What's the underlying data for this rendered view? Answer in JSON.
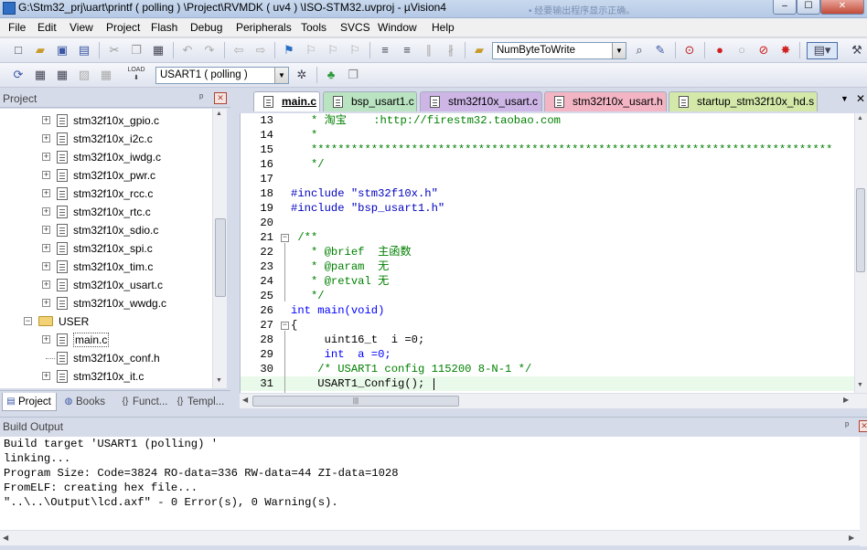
{
  "window": {
    "title": "G:\\Stm32_prj\\uart\\printf ( polling ) \\Project\\RVMDK ( uv4 ) \\ISO-STM32.uvproj - µVision4",
    "ghost_text": "• 经要输出程序显示正确。"
  },
  "menu": [
    "File",
    "Edit",
    "View",
    "Project",
    "Flash",
    "Debug",
    "Peripherals",
    "Tools",
    "SVCS",
    "Window",
    "Help"
  ],
  "toolbar": {
    "find_combo": "NumByteToWrite",
    "target_combo": "USART1 ( polling )",
    "load_label": "LOAD"
  },
  "project_panel": {
    "title": "Project",
    "pin": "ᵖ",
    "items": [
      {
        "label": "stm32f10x_gpio.c",
        "type": "file",
        "expandable": true
      },
      {
        "label": "stm32f10x_i2c.c",
        "type": "file",
        "expandable": true
      },
      {
        "label": "stm32f10x_iwdg.c",
        "type": "file",
        "expandable": true
      },
      {
        "label": "stm32f10x_pwr.c",
        "type": "file",
        "expandable": true
      },
      {
        "label": "stm32f10x_rcc.c",
        "type": "file",
        "expandable": true
      },
      {
        "label": "stm32f10x_rtc.c",
        "type": "file",
        "expandable": true
      },
      {
        "label": "stm32f10x_sdio.c",
        "type": "file",
        "expandable": true
      },
      {
        "label": "stm32f10x_spi.c",
        "type": "file",
        "expandable": true
      },
      {
        "label": "stm32f10x_tim.c",
        "type": "file",
        "expandable": true
      },
      {
        "label": "stm32f10x_usart.c",
        "type": "file",
        "expandable": true
      },
      {
        "label": "stm32f10x_wwdg.c",
        "type": "file",
        "expandable": true
      },
      {
        "label": "USER",
        "type": "folder",
        "expandable": true
      },
      {
        "label": "main.c",
        "type": "file",
        "expandable": true
      },
      {
        "label": "stm32f10x_conf.h",
        "type": "file",
        "expandable": false
      },
      {
        "label": "stm32f10x_it.c",
        "type": "file",
        "expandable": true
      }
    ],
    "tabs": [
      {
        "label": "Project",
        "icon": "project-icon"
      },
      {
        "label": "Books",
        "icon": "books-icon"
      },
      {
        "label": "Funct...",
        "icon": "functions-icon"
      },
      {
        "label": "Templ...",
        "icon": "templates-icon"
      }
    ]
  },
  "editor": {
    "tabs": [
      {
        "label": "main.c",
        "color": "#ffffff",
        "active": true
      },
      {
        "label": "bsp_usart1.c",
        "color": "#b9e3c1",
        "active": false
      },
      {
        "label": "stm32f10x_usart.c",
        "color": "#cdb6e6",
        "active": false
      },
      {
        "label": "stm32f10x_usart.h",
        "color": "#f3b5c4",
        "active": false
      },
      {
        "label": "startup_stm32f10x_hd.s",
        "color": "#d3e8a9",
        "active": false
      }
    ],
    "lines": [
      {
        "n": "13",
        "t": "   * 淘宝    :http://firestm32.taobao.com"
      },
      {
        "n": "14",
        "t": "   *"
      },
      {
        "n": "15",
        "t": "   ******************************************************************************"
      },
      {
        "n": "16",
        "t": "   */"
      },
      {
        "n": "17",
        "t": ""
      },
      {
        "n": "18",
        "t": "#include \"stm32f10x.h\""
      },
      {
        "n": "19",
        "t": "#include \"bsp_usart1.h\""
      },
      {
        "n": "20",
        "t": ""
      },
      {
        "n": "21",
        "t": " /**"
      },
      {
        "n": "22",
        "t": "   * @brief  主函数"
      },
      {
        "n": "23",
        "t": "   * @param  无"
      },
      {
        "n": "24",
        "t": "   * @retval 无"
      },
      {
        "n": "25",
        "t": "   */"
      },
      {
        "n": "26",
        "t": "int main(void)"
      },
      {
        "n": "27",
        "t": "{"
      },
      {
        "n": "28",
        "t": "     uint16_t  i =0;"
      },
      {
        "n": "29",
        "t": "     int  a =0;"
      },
      {
        "n": "30",
        "t": "    /* USART1 config 115200 8-N-1 */"
      },
      {
        "n": "31",
        "t": "    USART1_Config();"
      }
    ]
  },
  "build_output": {
    "title": "Build Output",
    "lines": [
      "Build target 'USART1 (polling) '",
      "linking...",
      "Program Size: Code=3824 RO-data=336 RW-data=44 ZI-data=1028",
      "FromELF: creating hex file...",
      "\"..\\..\\Output\\lcd.axf\" - 0 Error(s), 0 Warning(s)."
    ]
  }
}
